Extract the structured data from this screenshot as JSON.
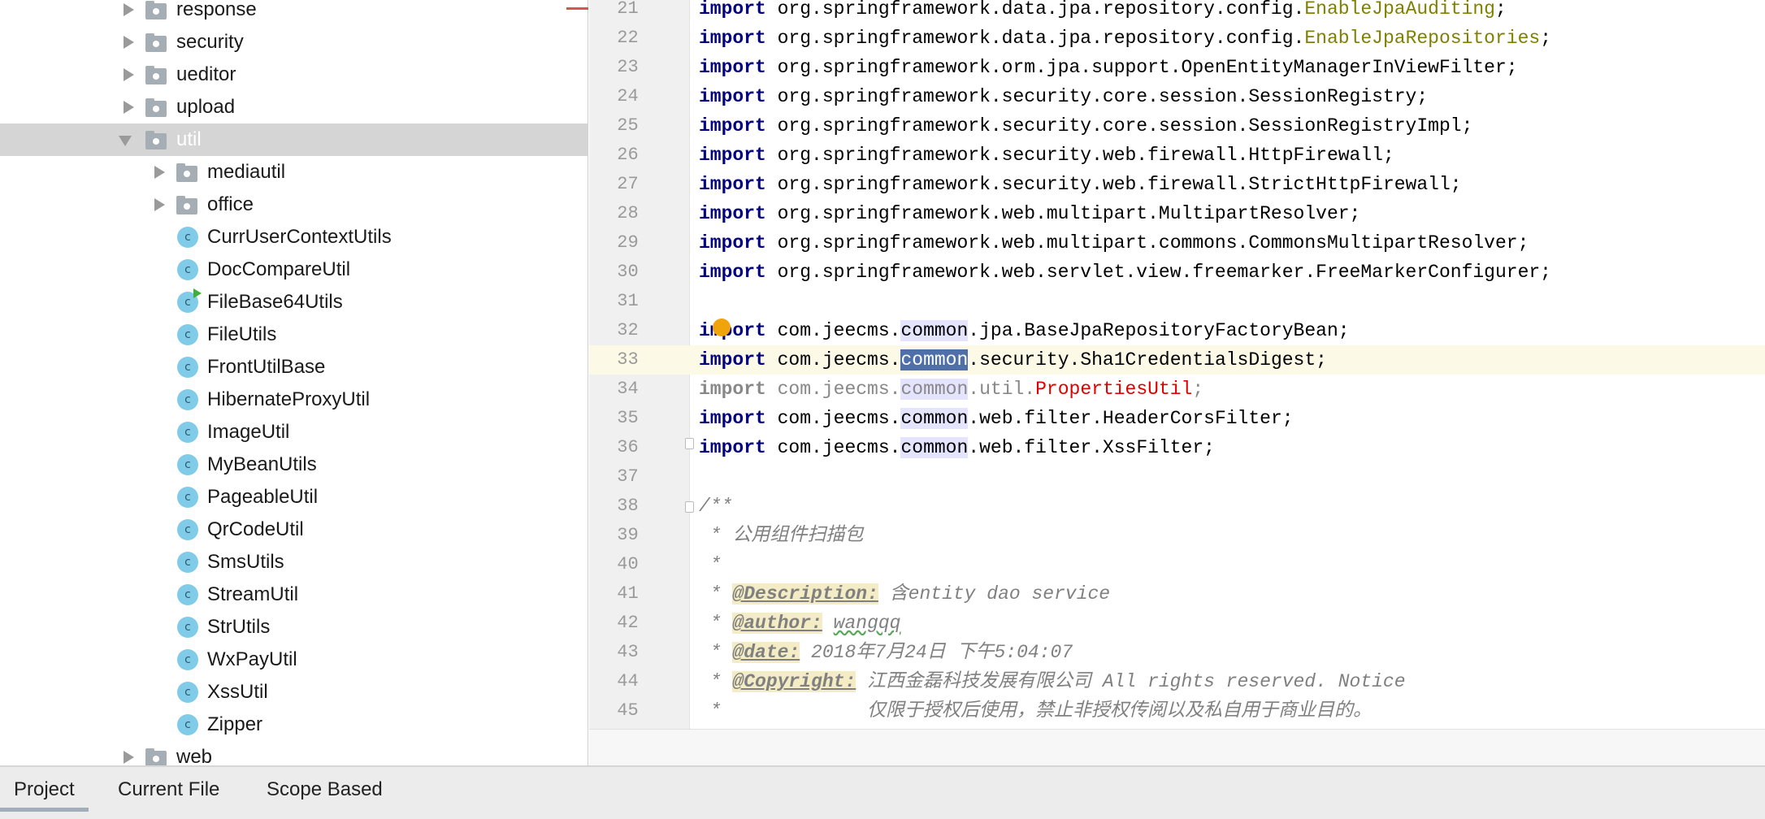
{
  "tree": [
    {
      "label": "response",
      "kind": "folder",
      "level": 1,
      "expanded": false
    },
    {
      "label": "security",
      "kind": "folder",
      "level": 1,
      "expanded": false
    },
    {
      "label": "ueditor",
      "kind": "folder",
      "level": 1,
      "expanded": false
    },
    {
      "label": "upload",
      "kind": "folder",
      "level": 1,
      "expanded": false
    },
    {
      "label": "util",
      "kind": "folder",
      "level": 1,
      "expanded": true,
      "selected": true
    },
    {
      "label": "mediautil",
      "kind": "folder",
      "level": 2,
      "expanded": false
    },
    {
      "label": "office",
      "kind": "folder",
      "level": 2,
      "expanded": false
    },
    {
      "label": "CurrUserContextUtils",
      "kind": "class",
      "level": 2
    },
    {
      "label": "DocCompareUtil",
      "kind": "class",
      "level": 2
    },
    {
      "label": "FileBase64Utils",
      "kind": "class",
      "level": 2,
      "runnable": true
    },
    {
      "label": "FileUtils",
      "kind": "class",
      "level": 2
    },
    {
      "label": "FrontUtilBase",
      "kind": "class",
      "level": 2
    },
    {
      "label": "HibernateProxyUtil",
      "kind": "class",
      "level": 2
    },
    {
      "label": "ImageUtil",
      "kind": "class",
      "level": 2
    },
    {
      "label": "MyBeanUtils",
      "kind": "class",
      "level": 2
    },
    {
      "label": "PageableUtil",
      "kind": "class",
      "level": 2
    },
    {
      "label": "QrCodeUtil",
      "kind": "class",
      "level": 2
    },
    {
      "label": "SmsUtils",
      "kind": "class",
      "level": 2
    },
    {
      "label": "StreamUtil",
      "kind": "class",
      "level": 2
    },
    {
      "label": "StrUtils",
      "kind": "class",
      "level": 2
    },
    {
      "label": "WxPayUtil",
      "kind": "class",
      "level": 2
    },
    {
      "label": "XssUtil",
      "kind": "class",
      "level": 2
    },
    {
      "label": "Zipper",
      "kind": "class",
      "level": 2
    },
    {
      "label": "web",
      "kind": "folder",
      "level": 1,
      "expanded": false
    }
  ],
  "class_icon_letter": "c",
  "editor": {
    "current_line": 33,
    "lines": [
      {
        "n": "21",
        "tokens": [
          [
            "import",
            "kw"
          ],
          [
            " org.springframework.data.jpa.repository.config.",
            ""
          ],
          [
            "EnableJpaAuditing",
            "ann"
          ],
          [
            ";",
            ""
          ]
        ]
      },
      {
        "n": "22",
        "tokens": [
          [
            "import",
            "kw"
          ],
          [
            " org.springframework.data.jpa.repository.config.",
            ""
          ],
          [
            "EnableJpaRepositories",
            "ann"
          ],
          [
            ";",
            ""
          ]
        ]
      },
      {
        "n": "23",
        "tokens": [
          [
            "import",
            "kw"
          ],
          [
            " org.springframework.orm.jpa.support.OpenEntityManagerInViewFilter;",
            ""
          ]
        ]
      },
      {
        "n": "24",
        "tokens": [
          [
            "import",
            "kw"
          ],
          [
            " org.springframework.security.core.session.SessionRegistry;",
            ""
          ]
        ]
      },
      {
        "n": "25",
        "tokens": [
          [
            "import",
            "kw"
          ],
          [
            " org.springframework.security.core.session.SessionRegistryImpl;",
            ""
          ]
        ]
      },
      {
        "n": "26",
        "tokens": [
          [
            "import",
            "kw"
          ],
          [
            " org.springframework.security.web.firewall.HttpFirewall;",
            ""
          ]
        ]
      },
      {
        "n": "27",
        "tokens": [
          [
            "import",
            "kw"
          ],
          [
            " org.springframework.security.web.firewall.StrictHttpFirewall;",
            ""
          ]
        ]
      },
      {
        "n": "28",
        "tokens": [
          [
            "import",
            "kw"
          ],
          [
            " org.springframework.web.multipart.MultipartResolver;",
            ""
          ]
        ]
      },
      {
        "n": "29",
        "tokens": [
          [
            "import",
            "kw"
          ],
          [
            " org.springframework.web.multipart.commons.CommonsMultipartResolver;",
            ""
          ]
        ]
      },
      {
        "n": "30",
        "tokens": [
          [
            "import",
            "kw"
          ],
          [
            " org.springframework.web.servlet.view.freemarker.FreeMarkerConfigurer;",
            ""
          ]
        ]
      },
      {
        "n": "31",
        "tokens": []
      },
      {
        "n": "32",
        "tokens": [
          [
            "import",
            "kw"
          ],
          [
            " com.jeecms.",
            ""
          ],
          [
            "common",
            "hl"
          ],
          [
            ".jpa.BaseJpaRepositoryFactoryBean;",
            ""
          ]
        ]
      },
      {
        "n": "33",
        "tokens": [
          [
            "import",
            "kw"
          ],
          [
            " com.jeecms.",
            ""
          ],
          [
            "common",
            "sel"
          ],
          [
            ".security.Sha1CredentialsDigest;",
            ""
          ]
        ]
      },
      {
        "n": "34",
        "tokens": [
          [
            "import",
            "kwdim"
          ],
          [
            " com.jeecms.",
            "dim"
          ],
          [
            "common",
            "hl dim"
          ],
          [
            ".util.",
            "dim"
          ],
          [
            "PropertiesUtil",
            "err"
          ],
          [
            ";",
            "dim"
          ]
        ]
      },
      {
        "n": "35",
        "tokens": [
          [
            "import",
            "kw"
          ],
          [
            " com.jeecms.",
            ""
          ],
          [
            "common",
            "hl"
          ],
          [
            ".web.filter.HeaderCorsFilter;",
            ""
          ]
        ]
      },
      {
        "n": "36",
        "tokens": [
          [
            "import",
            "kw"
          ],
          [
            " com.jeecms.",
            ""
          ],
          [
            "common",
            "hl"
          ],
          [
            ".web.filter.XssFilter;",
            ""
          ]
        ]
      },
      {
        "n": "37",
        "tokens": []
      },
      {
        "n": "38",
        "tokens": [
          [
            "/**",
            "cm"
          ]
        ]
      },
      {
        "n": "39",
        "tokens": [
          [
            " * 公用组件扫描包",
            "cm"
          ]
        ]
      },
      {
        "n": "40",
        "tokens": [
          [
            " *",
            "cm"
          ]
        ]
      },
      {
        "n": "41",
        "tokens": [
          [
            " * ",
            "cm"
          ],
          [
            "@Description:",
            "tag"
          ],
          [
            " 含entity dao service",
            "cm"
          ]
        ]
      },
      {
        "n": "42",
        "tokens": [
          [
            " * ",
            "cm"
          ],
          [
            "@author:",
            "tag"
          ],
          [
            " ",
            "cm"
          ],
          [
            "wangqq",
            "cm wavy"
          ]
        ]
      },
      {
        "n": "43",
        "tokens": [
          [
            " * ",
            "cm"
          ],
          [
            "@date:",
            "tag"
          ],
          [
            " 2018年7月24日 下午5:04:07",
            "cm"
          ]
        ]
      },
      {
        "n": "44",
        "tokens": [
          [
            " * ",
            "cm"
          ],
          [
            "@Copyright:",
            "tag"
          ],
          [
            " 江西金磊科技发展有限公司 All rights reserved. Notice",
            "cm"
          ]
        ]
      },
      {
        "n": "45",
        "tokens": [
          [
            " *             仅限于授权后使用，禁止非授权传阅以及私自用于商业目的。",
            "cm"
          ]
        ]
      }
    ]
  },
  "tabs": [
    {
      "label": "Project",
      "active": true
    },
    {
      "label": "Current File"
    },
    {
      "label": "Scope Based"
    }
  ]
}
